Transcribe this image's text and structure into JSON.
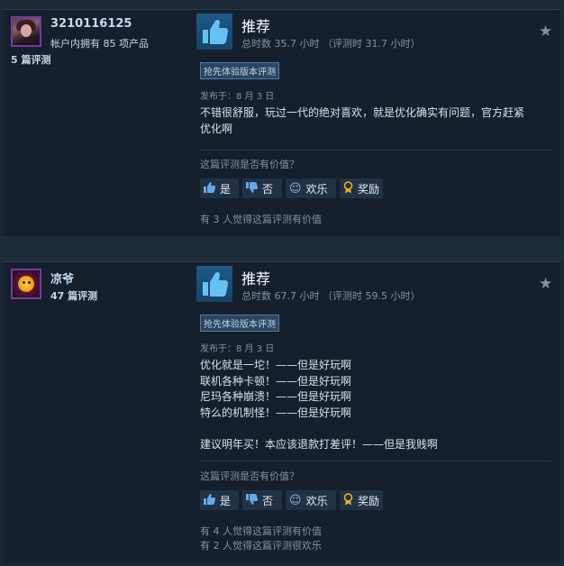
{
  "reviews": [
    {
      "username": "3210116125",
      "owned_text": "帐户内拥有 85 项产品",
      "review_count": "5 篇评测",
      "recommendation": "推荐",
      "hours": "总时数 35.7 小时 （评测时 31.7 小时）",
      "badge": "抢先体验版本评测",
      "posted": "发布于：8 月 3 日",
      "body_lines": [
        "不错很舒服，玩过一代的绝对喜欢，就是优化确实有问题，官方赶紧",
        "优化啊"
      ],
      "helpful_question": "这篇评测是否有价值？",
      "buttons": {
        "yes": "是",
        "no": "否",
        "funny": "欢乐",
        "award": "奖励"
      },
      "notes": [
        "有 3 人觉得这篇评测有价值"
      ],
      "accent_colors": {
        "avatar_border": "#6b3fa0"
      }
    },
    {
      "username": "凉爷",
      "owned_text": "",
      "review_count": "47 篇评测",
      "recommendation": "推荐",
      "hours": "总时数 67.7 小时 （评测时 59.5 小时）",
      "badge": "抢先体验版本评测",
      "posted": "发布于：8 月 3 日",
      "body_lines": [
        "优化就是一坨！——但是好玩啊",
        "联机各种卡顿！——但是好玩啊",
        "尼玛各种崩溃！——但是好玩啊",
        "特么的机制怪！——但是好玩啊",
        "",
        "建议明年买！本应该退款打差评！——但是我贱啊"
      ],
      "helpful_question": "这篇评测是否有价值？",
      "buttons": {
        "yes": "是",
        "no": "否",
        "funny": "欢乐",
        "award": "奖励"
      },
      "notes": [
        "有 4 人觉得这篇评测有价值",
        "有 2 人觉得这篇评测很欢乐"
      ],
      "accent_colors": {
        "avatar_border": "#6b3fa0"
      }
    }
  ],
  "icons": {
    "thumbs_up": "thumbs-up-icon",
    "thumbs_down": "thumbs-down-icon",
    "smile": "smile-icon",
    "award": "award-icon",
    "star": "star-icon"
  }
}
